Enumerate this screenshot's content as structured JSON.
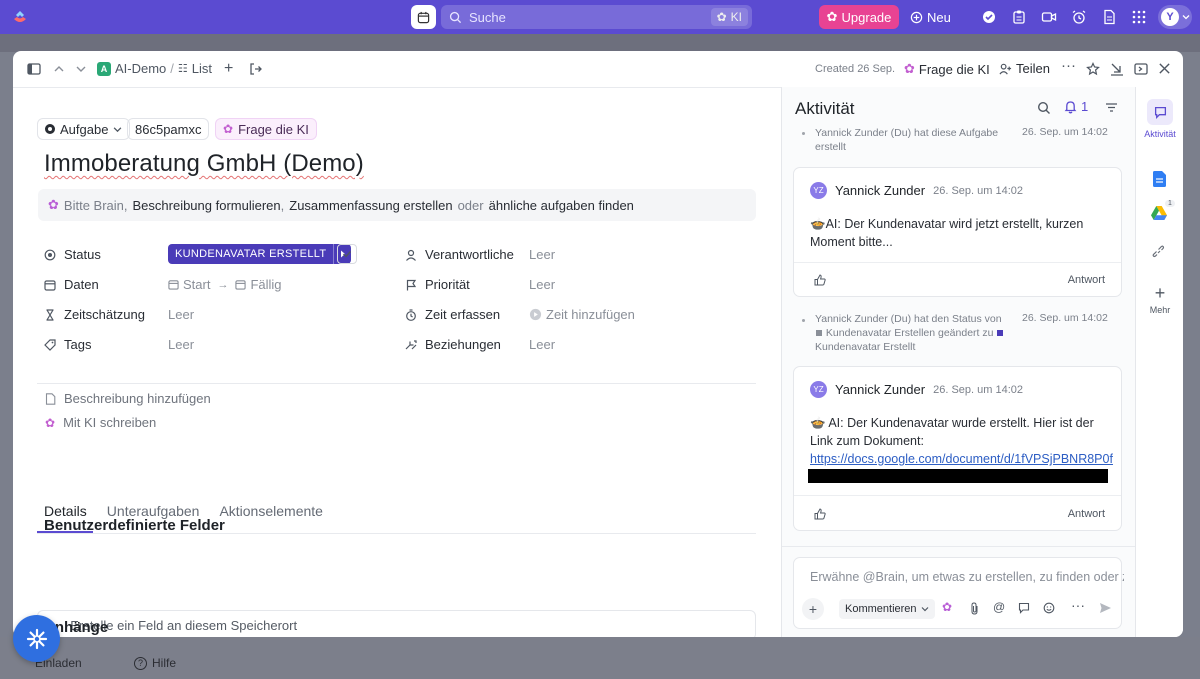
{
  "appbar": {
    "search_placeholder": "Suche",
    "search_ki": "KI",
    "upgrade_label": "Upgrade",
    "new_label": "Neu",
    "avatar_initial": "Y",
    "accent": "#5b4bd1",
    "upgrade_color": "#e84393"
  },
  "breadcrumb": {
    "workspace_initial": "A",
    "workspace": "AI-Demo",
    "separator": "/",
    "list": "List"
  },
  "modal_header": {
    "created": "Created 26 Sep.",
    "ask_ai": "Frage die KI",
    "share": "Teilen"
  },
  "task": {
    "type_label": "Aufgabe",
    "id": "86c5pamxc",
    "ask_ai": "Frage die KI",
    "title": "Immoberatung GmbH (Demo)"
  },
  "brain_bar": {
    "prefix": "Bitte Brain,",
    "opt1": "Beschreibung formulieren",
    "comma": ",",
    "opt2": "Zusammenfassung erstellen",
    "or": "oder",
    "opt3": "ähnliche aufgaben finden"
  },
  "fields": {
    "status_label": "Status",
    "status_value": "KUNDENAVATAR ERSTELLT",
    "dates_label": "Daten",
    "start": "Start",
    "due": "Fällig",
    "estimate_label": "Zeitschätzung",
    "estimate_value": "Leer",
    "tags_label": "Tags",
    "tags_value": "Leer",
    "assignee_label": "Verantwortliche",
    "assignee_value": "Leer",
    "priority_label": "Priorität",
    "priority_value": "Leer",
    "track_label": "Zeit erfassen",
    "track_value": "Zeit hinzufügen",
    "relations_label": "Beziehungen",
    "relations_value": "Leer"
  },
  "description": {
    "add": "Beschreibung hinzufügen",
    "ai_write": "Mit KI schreiben"
  },
  "tabs": [
    "Details",
    "Unteraufgaben",
    "Aktionselemente"
  ],
  "custom_fields": {
    "heading": "Benutzerdefinierte Felder",
    "add_field": "Erstelle ein Feld an diesem Speicherort"
  },
  "attachments_heading": "Anhänge",
  "background": {
    "invite": "Einladen",
    "help": "Hilfe"
  },
  "activity": {
    "title": "Aktivität",
    "notif_count": "1",
    "event1": "Yannick Zunder (Du) hat diese Aufgabe erstellt",
    "event1_date": "26. Sep. um 14:02",
    "comment1": {
      "initials": "YZ",
      "author": "Yannick Zunder",
      "date": "26. Sep. um 14:02",
      "text": "🍲AI: Der Kundenavatar wird jetzt erstellt, kurzen Moment bitte...",
      "reply": "Antwort"
    },
    "event2": "Yannick Zunder (Du) hat den Status von Kundenavatar Erstellen geändert zu Kundenavatar Erstellt",
    "event2_a": "Yannick Zunder (Du) hat den Status von",
    "event2_b": "Kundenavatar Erstellen geändert zu",
    "event2_c": "Kundenavatar Erstellt",
    "event2_date": "26. Sep. um 14:02",
    "comment2": {
      "initials": "YZ",
      "author": "Yannick Zunder",
      "date": "26. Sep. um 14:02",
      "text": "🍲 AI: Der Kundenavatar wurde erstellt. Hier ist der Link zum Dokument:",
      "link": "https://docs.google.com/document/d/1fVPSjPBNR8P0f",
      "reply": "Antwort"
    },
    "composer_placeholder": "Erwähne @Brain, um etwas zu erstellen, zu finden oder zu fragen",
    "composer_mode": "Kommentieren"
  },
  "rail": {
    "activity": "Aktivität",
    "more": "Mehr",
    "drive_badge": "1"
  }
}
